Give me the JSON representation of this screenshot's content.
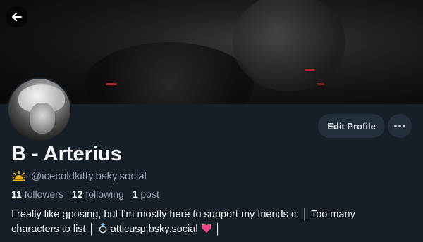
{
  "header": {
    "back_icon": "arrow-left-icon"
  },
  "profile": {
    "display_name": "B - Arterius",
    "handle_emoji_icon": "sun-icon",
    "handle": "@icecoldkitty.bsky.social",
    "edit_label": "Edit Profile",
    "more_icon": "more-horizontal-icon",
    "stats": {
      "followers_count": "11",
      "followers_label": "followers",
      "following_count": "12",
      "following_label": "following",
      "posts_count": "1",
      "posts_label": "post"
    },
    "bio": {
      "line1": "I really like gposing, but I'm mostly here to support my friends c: │ Too many",
      "line2_part1": "characters to list │ ",
      "ring_icon": "ring-icon",
      "line2_part2": " atticusp.bsky.social ",
      "heart_icon": "sparkling-heart-icon",
      "line2_part3": " │"
    }
  },
  "colors": {
    "background": "#161e27",
    "button_bg": "#242f3c",
    "muted_text": "#97a3b0",
    "accent_red": "#b3202a"
  }
}
